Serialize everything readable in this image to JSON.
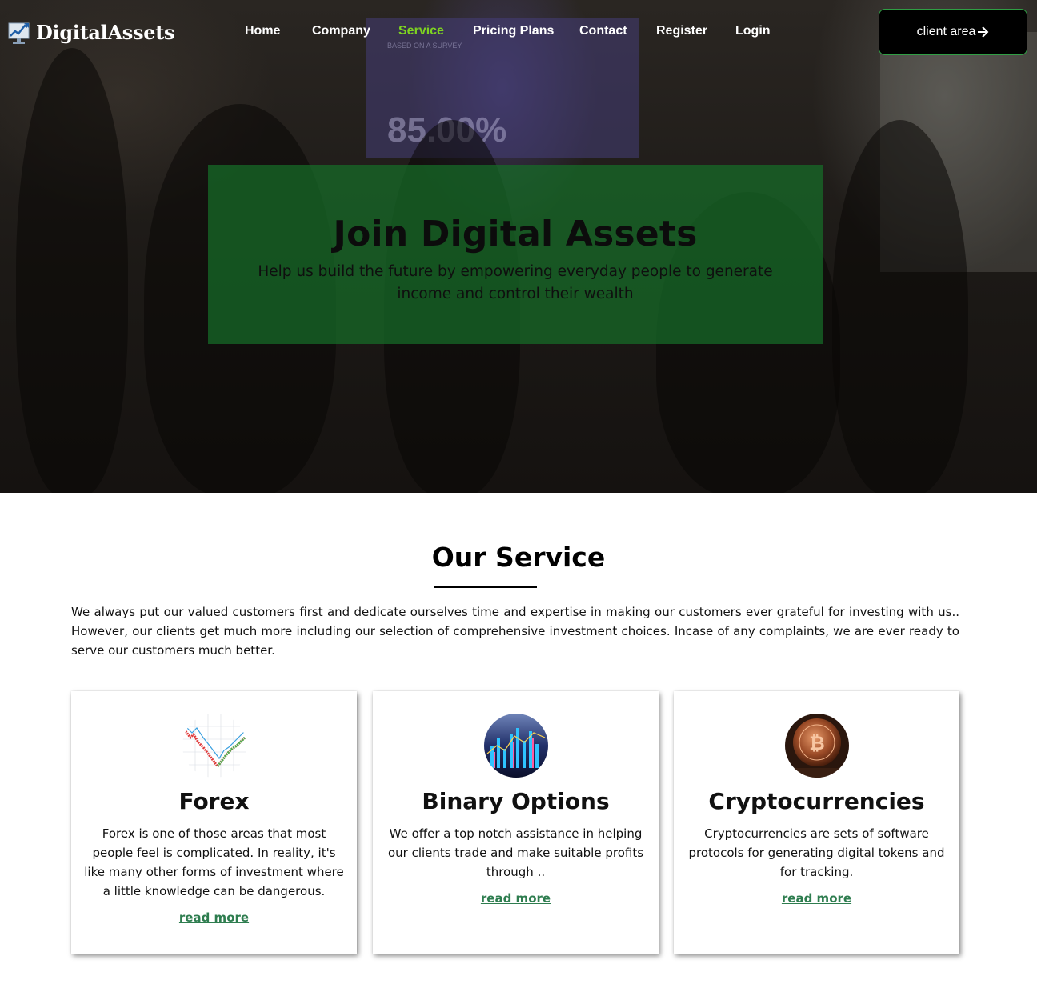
{
  "brand": {
    "name": "DigitalAssets",
    "icon": "chart-monitor-icon"
  },
  "nav": {
    "items": [
      {
        "label": "Home",
        "active": false
      },
      {
        "label": "Company",
        "active": false
      },
      {
        "label": "Service",
        "active": true
      },
      {
        "label": "Pricing Plans",
        "active": false
      },
      {
        "label": "Contact",
        "active": false
      },
      {
        "label": "Register",
        "active": false
      },
      {
        "label": "Login",
        "active": false
      }
    ],
    "cta_label": "client area",
    "cta_icon": "arrow-right-icon"
  },
  "hero": {
    "title": "Join Digital Assets",
    "subtitle": "Help us build the future by empowering everyday people to generate income and control their wealth",
    "background_screen_text": "BASED ON A SURVEY",
    "background_screen_number": "85.00%"
  },
  "services": {
    "title": "Our Service",
    "intro": "We always put our valued customers first and dedicate ourselves time and expertise in making our customers ever grateful for investing with us.. However, our clients get much more including our selection of comprehensive investment choices. Incase of any complaints, we are ever ready to serve our customers much better.",
    "cards": [
      {
        "title": "Forex",
        "text": "Forex is one of those areas that most people feel is complicated. In reality, it's like many other forms of investment where a little knowledge can be dangerous.",
        "link": "read more",
        "image": "forex-chart-image"
      },
      {
        "title": "Binary Options",
        "text": "We offer a top notch assistance in helping our clients trade and make suitable profits through ..",
        "link": "read more",
        "image": "binary-options-image"
      },
      {
        "title": "Cryptocurrencies",
        "text": "Cryptocurrencies are sets of software protocols for generating digital tokens and for tracking.",
        "link": "read more",
        "image": "bitcoin-coin-image"
      }
    ]
  },
  "colors": {
    "accent_green": "#7ed321",
    "banner_green": "#166e28",
    "link_green": "#2e7d4f",
    "cta_border": "#2f9e44"
  }
}
